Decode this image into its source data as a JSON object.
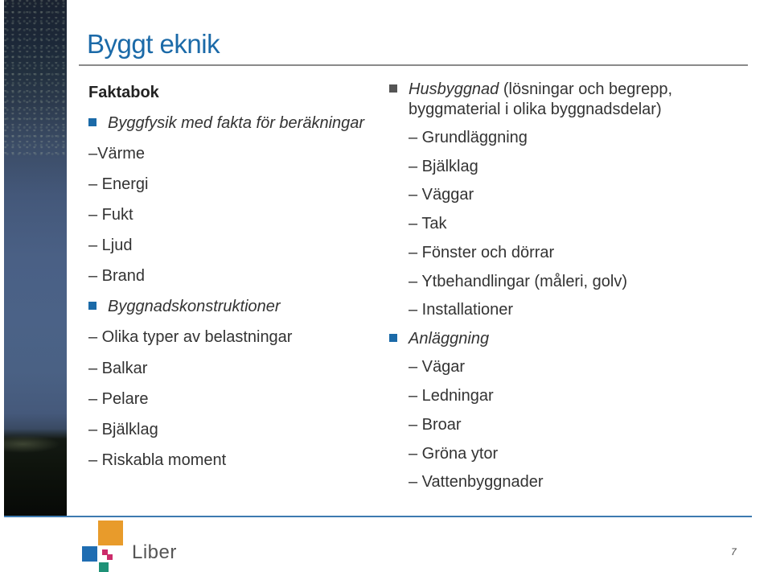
{
  "slide": {
    "title": "Byggt eknik",
    "page_number": "7"
  },
  "left_column": {
    "heading": "Faktabok",
    "items": [
      {
        "type": "bullet",
        "text": "Byggfysik med fakta för beräkningar",
        "italic": true
      },
      {
        "type": "dash",
        "text": "–Värme"
      },
      {
        "type": "dash",
        "text": "– Energi"
      },
      {
        "type": "dash",
        "text": "– Fukt"
      },
      {
        "type": "dash",
        "text": "– Ljud"
      },
      {
        "type": "dash",
        "text": "– Brand"
      },
      {
        "type": "bullet",
        "text": "Byggnadskonstruktioner",
        "italic": true
      },
      {
        "type": "dash",
        "text": "– Olika typer av belastningar"
      },
      {
        "type": "dash",
        "text": "– Balkar"
      },
      {
        "type": "dash",
        "text": "– Pelare"
      },
      {
        "type": "dash",
        "text": "– Bjälklag"
      },
      {
        "type": "dash",
        "text": "– Riskabla moment"
      }
    ]
  },
  "right_column": {
    "first_bullet": {
      "italic_part": "Husbyggnad",
      "rest_line1": " (lösningar och begrepp,",
      "line2": "byggmaterial i olika byggnadsdelar)"
    },
    "husbyggnad_items": [
      "– Grundläggning",
      "– Bjälklag",
      "– Väggar",
      "– Tak",
      "– Fönster och dörrar",
      "– Ytbehandlingar (måleri, golv)",
      "– Installationer"
    ],
    "second_bullet": "Anläggning",
    "anlaggning_items": [
      "– Vägar",
      "– Ledningar",
      "– Broar",
      "– Gröna ytor",
      "– Vattenbyggnader"
    ]
  },
  "footer": {
    "logo_text": "Liber"
  },
  "colors": {
    "accent_blue": "#1b6aa8",
    "gray_bullet": "#555555",
    "logo_orange": "#e89b2b",
    "logo_blue": "#1f6db2",
    "logo_pink": "#cc2c6b",
    "logo_teal": "#1f9277"
  }
}
